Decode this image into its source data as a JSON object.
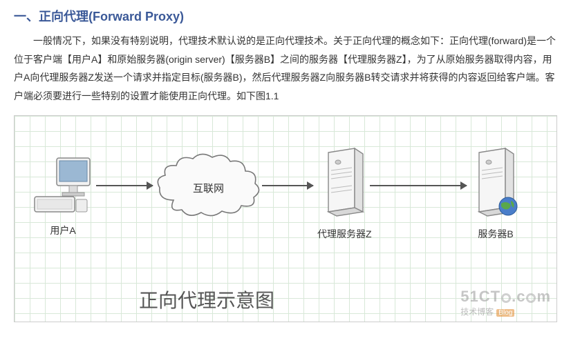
{
  "heading": "一、正向代理(Forward Proxy)",
  "paragraph": "一般情况下，如果没有特别说明，代理技术默认说的是正向代理技术。关于正向代理的概念如下：正向代理(forward)是一个位于客户端【用户A】和原始服务器(origin server)【服务器B】之间的服务器【代理服务器Z】，为了从原始服务器取得内容，用户A向代理服务器Z发送一个请求并指定目标(服务器B)，然后代理服务器Z向服务器B转交请求并将获得的内容返回给客户端。客户端必须要进行一些特别的设置才能使用正向代理。如下图1.1",
  "diagram": {
    "title": "正向代理示意图",
    "nodes": {
      "userA": "用户A",
      "internet": "互联网",
      "proxyZ": "代理服务器Z",
      "serverB": "服务器B"
    },
    "watermark": {
      "line1": "51CTO.com",
      "line2": "技术博客",
      "badge": "Blog"
    }
  }
}
